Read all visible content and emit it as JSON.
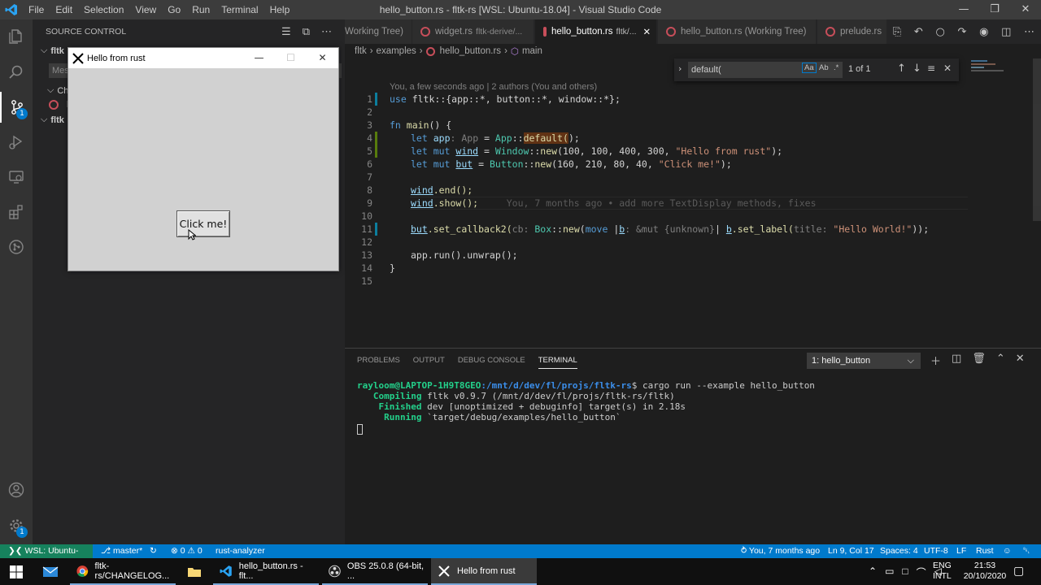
{
  "titlebar": {
    "menu": [
      "File",
      "Edit",
      "Selection",
      "View",
      "Go",
      "Run",
      "Terminal",
      "Help"
    ],
    "title": "hello_button.rs - fltk-rs [WSL: Ubuntu-18.04] - Visual Studio Code"
  },
  "sidebar": {
    "header": "SOURCE CONTROL",
    "rows": [
      "fltk",
      "Mes",
      "Ch",
      "h",
      "fltk"
    ]
  },
  "app_window": {
    "title": "Hello from rust",
    "button_label": "Click me!"
  },
  "tabs": [
    {
      "label": "Working Tree)",
      "desc": ""
    },
    {
      "label": "widget.rs",
      "desc": "fltk-derive/..."
    },
    {
      "label": "hello_button.rs",
      "desc": "fltk/..."
    },
    {
      "label": "hello_button.rs (Working Tree)",
      "desc": ""
    },
    {
      "label": "prelude.rs",
      "desc": ""
    }
  ],
  "breadcrumb": [
    "fltk",
    "examples",
    "hello_button.rs",
    "main"
  ],
  "find": {
    "query": "default(",
    "result": "1 of 1",
    "opt_case": "Aa",
    "opt_word": "Ab",
    "opt_regex": ".*"
  },
  "editor": {
    "blame_header": "You, a few seconds ago | 2 authors (You and others)",
    "line_numbers": [
      "1",
      "2",
      "3",
      "4",
      "5",
      "6",
      "7",
      "8",
      "9",
      "10",
      "11",
      "12",
      "13",
      "14",
      "15"
    ],
    "line1": {
      "use": "use",
      "path": " fltk::{app::*, button::*, window::*};"
    },
    "line3": {
      "fn": "fn",
      "name": "main",
      "rest": "() {"
    },
    "line4": {
      "let": "let",
      "var": "app",
      "colon": ": ",
      "type": "App",
      "eq": " = ",
      "tp2": "App",
      "sep": "::",
      "call": "default(",
      "end": ");"
    },
    "line5": {
      "kw": "let mut",
      "var": "wind",
      "eq": " = ",
      "type": "Window",
      "sep": "::",
      "fn": "new",
      "args": "(100, 100, 400, 300, ",
      "str": "\"Hello from rust\"",
      "end": ");"
    },
    "line6": {
      "kw": "let mut",
      "var": "but",
      "eq": " = ",
      "type": "Button",
      "sep": "::",
      "fn": "new",
      "args": "(160, 210, 80, 40, ",
      "str": "\"Click me!\"",
      "end": ");"
    },
    "line8": {
      "var": "wind",
      "rest": ".end();"
    },
    "line9": {
      "var": "wind",
      "rest": ".show();",
      "ghost": "You, 7 months ago • add more TextDisplay methods, fixes"
    },
    "line11": {
      "var": "but",
      "fn": ".set_callback2(",
      "hint1": "cb: ",
      "type": "Box",
      "sep": "::",
      "new": "new",
      "p": "(",
      "kw": "move",
      "mid": " |",
      "b": "b",
      "hint2": ": &mut {unknown}",
      "bar": "| ",
      "b2": "b",
      "fn2": ".set_label(",
      "hint3": "title: ",
      "str": "\"Hello World!\"",
      "end": "));"
    },
    "line13": {
      "text": "app.run().unwrap();"
    },
    "line14": {
      "text": "}"
    }
  },
  "panel": {
    "tabs": [
      "PROBLEMS",
      "OUTPUT",
      "DEBUG CONSOLE",
      "TERMINAL"
    ],
    "terminal_select": "1: hello_button",
    "terminal": {
      "user": "rayloom@LAPTOP-1H9T8GEO",
      "path": ":/mnt/d/dev/fl/projs/fltk-rs",
      "cmd": "$ cargo run --example hello_button",
      "l2_label": "   Compiling",
      "l2_text": " fltk v0.9.7 (/mnt/d/dev/fl/projs/fltk-rs/fltk)",
      "l3_label": "    Finished",
      "l3_text": " dev [unoptimized + debuginfo] target(s) in 2.18s",
      "l4_label": "     Running",
      "l4_text": " `target/debug/examples/hello_button`"
    }
  },
  "statusbar": {
    "remote": "WSL: Ubuntu-18.04",
    "branch": "master*",
    "errors": "0",
    "warnings": "0",
    "analyzer": "rust-analyzer",
    "blame": "You, 7 months ago",
    "position": "Ln 9, Col 17",
    "spaces": "Spaces: 4",
    "encoding": "UTF-8",
    "eol": "LF",
    "language": "Rust"
  },
  "taskbar": {
    "items": [
      "fltk-rs/CHANGELOG...",
      "hello_button.rs - flt...",
      "OBS 25.0.8 (64-bit, ...",
      "Hello from rust"
    ],
    "lang_line1": "ENG",
    "lang_line2": "INTL",
    "time": "21:53",
    "date": "20/10/2020"
  },
  "colors": {
    "accent": "#007acc",
    "remote": "#16825d",
    "rust_icon": "#c74e5a"
  }
}
